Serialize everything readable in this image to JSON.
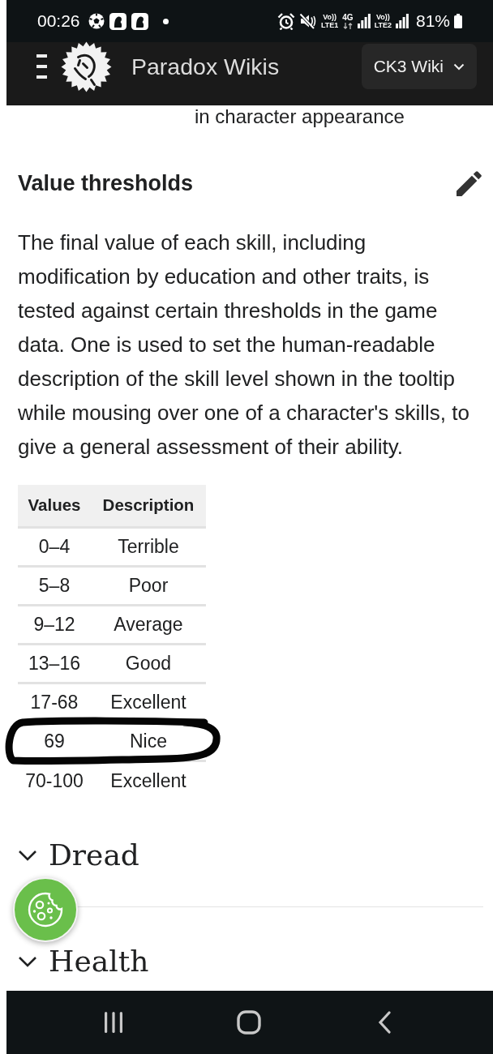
{
  "status_bar": {
    "time": "00:26",
    "sims": [
      {
        "volte": "Vo))",
        "network": "LTE1",
        "data_type": "4G"
      },
      {
        "volte": "Vo))",
        "network": "LTE2"
      }
    ],
    "battery": "81%"
  },
  "header": {
    "site_title": "Paradox Wikis",
    "wiki_selector": "CK3 Wiki"
  },
  "article": {
    "cut_off_text": "in character appearance",
    "section_heading": "Value thresholds",
    "paragraph": "The final value of each skill, including modification by education and other traits, is tested against certain thresholds in the game data. One is used to set the human-readable description of the skill level shown in the tooltip while mousing over one of a character's skills, to give a general assessment of their ability.",
    "table": {
      "columns": [
        "Values",
        "Description"
      ],
      "rows": [
        {
          "values": "0–4",
          "description": "Terrible",
          "circled": false
        },
        {
          "values": "5–8",
          "description": "Poor",
          "circled": false
        },
        {
          "values": "9–12",
          "description": "Average",
          "circled": false
        },
        {
          "values": "13–16",
          "description": "Good",
          "circled": false
        },
        {
          "values": "17-68",
          "description": "Excellent",
          "circled": false
        },
        {
          "values": "69",
          "description": "Nice",
          "circled": true
        },
        {
          "values": "70-100",
          "description": "Excellent",
          "circled": false
        }
      ]
    }
  },
  "sections": [
    {
      "title": "Dread"
    },
    {
      "title": "Health"
    }
  ]
}
